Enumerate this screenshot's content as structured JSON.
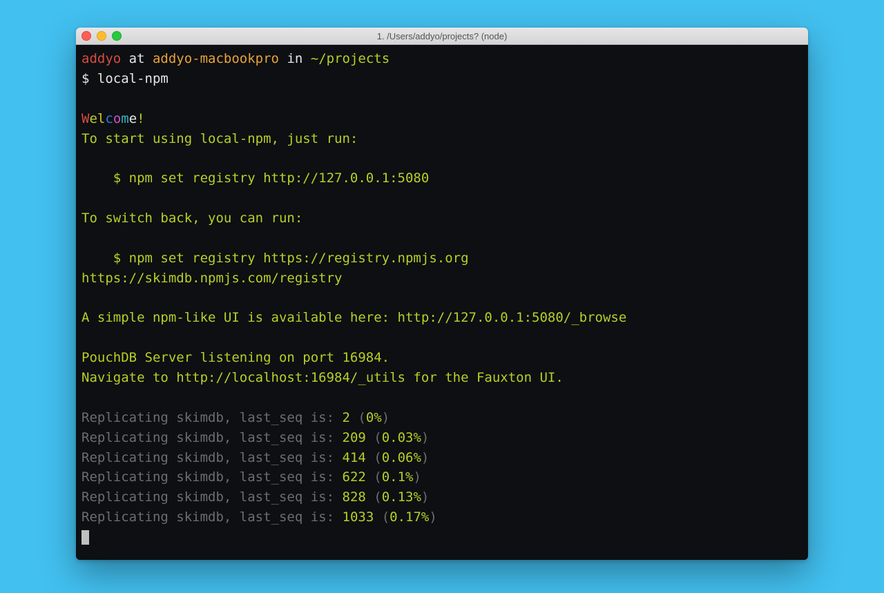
{
  "window": {
    "title": "1. /Users/addyo/projects? (node)"
  },
  "prompt": {
    "user": "addyo",
    "at": " at ",
    "host": "addyo-macbookpro",
    "in": " in ",
    "path": "~/projects",
    "symbol": "$ ",
    "command": "local-npm"
  },
  "welcome": {
    "letters": [
      "W",
      "e",
      "l",
      "c",
      "o",
      "m",
      "e",
      "!"
    ]
  },
  "lines": {
    "start_hint": "To start using local-npm, just run:",
    "set_registry_local": "    $ npm set registry http://127.0.0.1:5080",
    "switch_back": "To switch back, you can run:",
    "set_registry_npm": "    $ npm set registry https://registry.npmjs.org",
    "skimdb_url": "https://skimdb.npmjs.com/registry",
    "ui_hint": "A simple npm-like UI is available here: http://127.0.0.1:5080/_browse",
    "pouch_listening": "PouchDB Server listening on port 16984.",
    "fauxton_hint": "Navigate to http://localhost:16984/_utils for the Fauxton UI."
  },
  "replication_prefix": "Replicating skimdb, last_seq is: ",
  "replication": [
    {
      "seq": "2",
      "pct": "0%"
    },
    {
      "seq": "209",
      "pct": "0.03%"
    },
    {
      "seq": "414",
      "pct": "0.06%"
    },
    {
      "seq": "622",
      "pct": "0.1%"
    },
    {
      "seq": "828",
      "pct": "0.13%"
    },
    {
      "seq": "1033",
      "pct": "0.17%"
    }
  ]
}
